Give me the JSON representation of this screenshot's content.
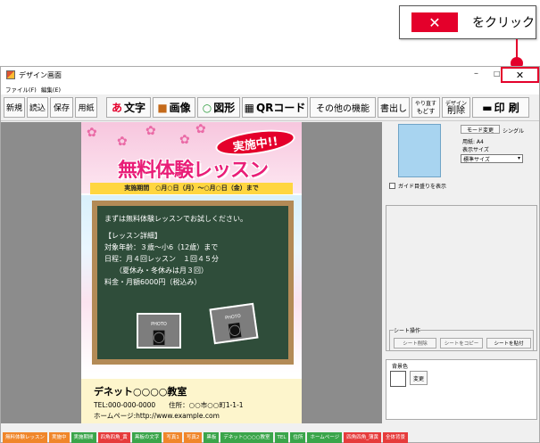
{
  "callout": {
    "x_label": "✕",
    "text": "をクリック",
    "color": "#e4002b"
  },
  "window": {
    "title": "デザイン画面",
    "min": "–",
    "max": "□",
    "close": "✕"
  },
  "menu": [
    "ファイル(F)",
    "編集(E)"
  ],
  "toolbar": {
    "new": "新規",
    "open": "読込",
    "save": "保存",
    "paper": "用紙",
    "text": "文字",
    "text_glyph": "あ",
    "image": "画像",
    "shape": "図形",
    "qr": "QRコード",
    "other": "その他の機能",
    "write": "書出し",
    "undo1": "やり直す",
    "undo2": "もどす",
    "del1": "デザイン",
    "del2": "削除",
    "print": "印 刷"
  },
  "poster": {
    "badge": "実施中!!",
    "title": "無料体験レッスン",
    "period": "実施期間　○月○日（月）〜○月○日（金）まで",
    "lines": [
      "まずは無料体験レッスンでお試しください。",
      "",
      "【レッスン詳細】",
      "対象年齢：３歳〜小6（12歳）まで",
      "日程：月４回レッスン　１回４５分",
      "　　（夏休み・冬休みは月３回）",
      "料金・月額6000円（税込み）"
    ],
    "photo": "PHOTO",
    "school": "デネット○○○○教室",
    "tel": "TEL:000-000-0000　　住所：○○市○○町1-1-1",
    "web": "ホームページ:http://www.example.com"
  },
  "right": {
    "mode": "モード変更",
    "single": "シングル",
    "paper": "用紙: A4",
    "sizeLabel": "表示サイズ",
    "size": "標準サイズ",
    "guide": "ガイド目盛りを表示",
    "sheetOps": "シート操作",
    "sheetDel": "シート削除",
    "sheetCopy": "シートをコピー",
    "sheetPaste": "シートを貼付",
    "bg": "背景色",
    "change": "変更"
  },
  "tabs": [
    {
      "t": "無料体験レッスン",
      "c": "#f0862a"
    },
    {
      "t": "実施中",
      "c": "#f0862a"
    },
    {
      "t": "実施期間",
      "c": "#3aa54a"
    },
    {
      "t": "四角四角_黄",
      "c": "#e63b3b"
    },
    {
      "t": "黒板の文字",
      "c": "#3aa54a"
    },
    {
      "t": "写真1",
      "c": "#f0862a"
    },
    {
      "t": "写真2",
      "c": "#f0862a"
    },
    {
      "t": "黒板",
      "c": "#3aa54a"
    },
    {
      "t": "デネット○○○○教室",
      "c": "#3aa54a"
    },
    {
      "t": "TEL",
      "c": "#3aa54a"
    },
    {
      "t": "住所",
      "c": "#3aa54a"
    },
    {
      "t": "ホームページ",
      "c": "#3aa54a"
    },
    {
      "t": "四角四角_薄黄",
      "c": "#e63b3b"
    },
    {
      "t": "全体背景",
      "c": "#e63b3b"
    }
  ]
}
